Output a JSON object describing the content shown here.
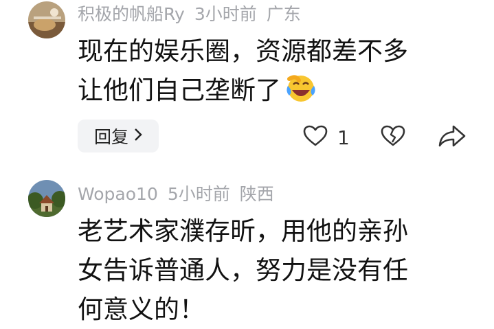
{
  "comments": [
    {
      "username": "积极的帆船Ry",
      "time": "3小时前",
      "location": "广东",
      "lines": [
        "现在的娱乐圈，资源都差不多",
        "让他们自己垄断了"
      ],
      "emoji": "laughing-crying-face",
      "reply_label": "回复",
      "like_count": "1"
    },
    {
      "username": "Wopao10",
      "time": "5小时前",
      "location": "陕西",
      "lines": [
        "老艺术家濮存昕，用他的亲孙",
        "女告诉普通人，努力是没有任",
        "何意义的！"
      ]
    }
  ]
}
